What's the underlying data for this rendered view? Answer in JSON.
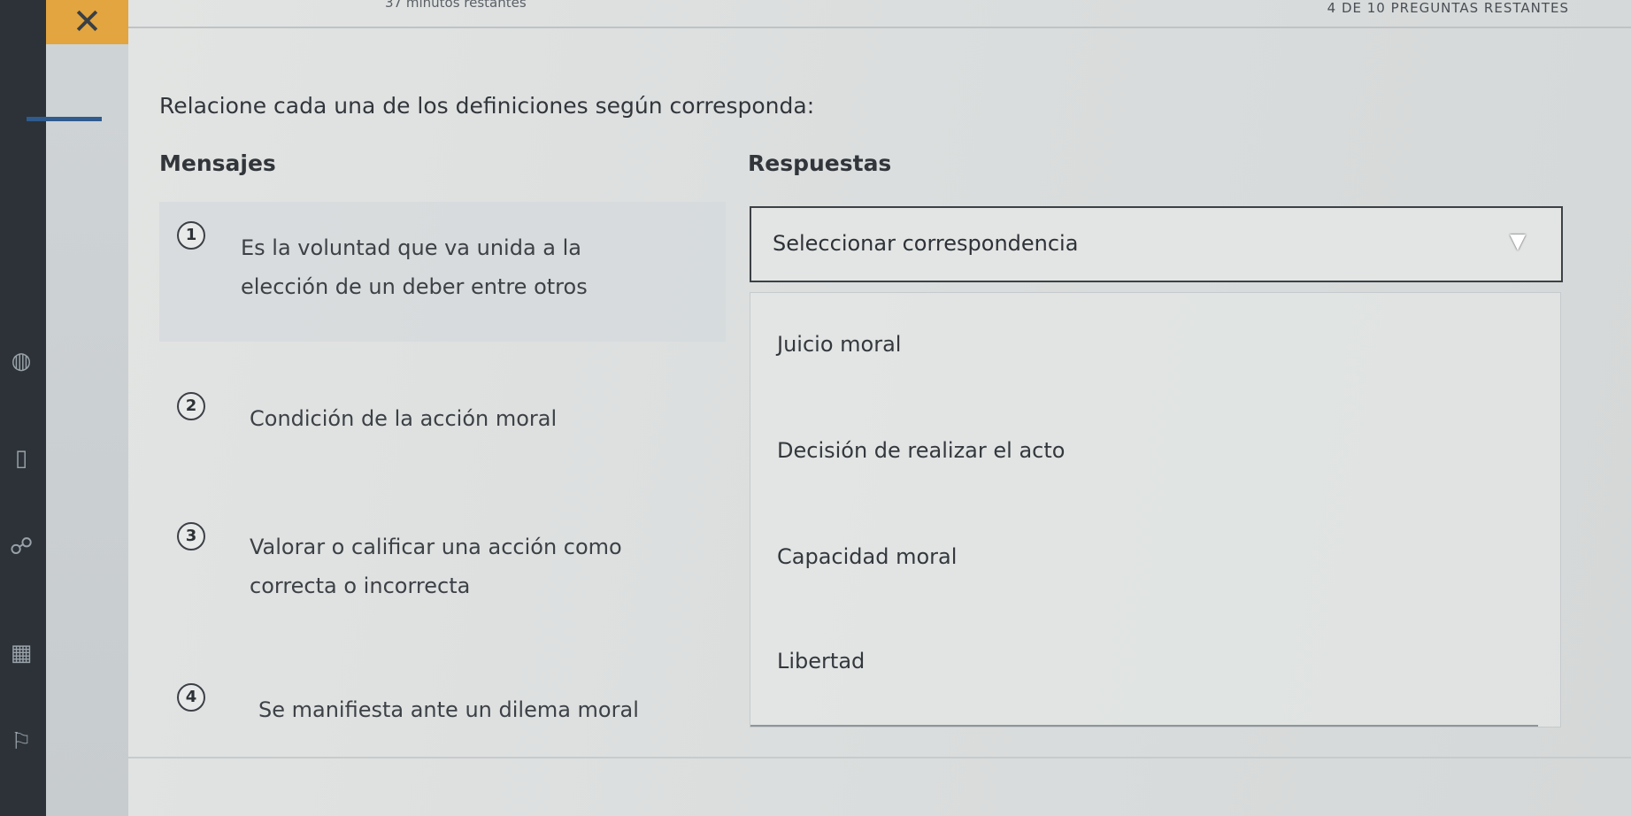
{
  "header": {
    "timer_text": "37 minutos restantes",
    "remaining_text": "4 DE 10 PREGUNTAS RESTANTES"
  },
  "close_button": {
    "symbol": "✕"
  },
  "instruction": "Relacione cada una de los definiciones según corresponda:",
  "columns": {
    "left_title": "Mensajes",
    "right_title": "Respuestas"
  },
  "questions": [
    {
      "num": "1",
      "text": "Es la voluntad que va unida a la elección de un deber entre otros"
    },
    {
      "num": "2",
      "text": "Condición de la acción moral"
    },
    {
      "num": "3",
      "text": "Valorar o calificar una acción como correcta o incorrecta"
    },
    {
      "num": "4",
      "text": "Se manifiesta ante un dilema moral"
    }
  ],
  "select": {
    "placeholder": "Seleccionar correspondencia",
    "options": [
      "Juicio moral",
      "Decisión de realizar el acto",
      "Capacidad moral",
      "Libertad"
    ]
  },
  "icons": {
    "close": "close-icon",
    "dropdown": "cursor-arrow-icon"
  },
  "colors": {
    "accent_orange": "#e2a53f",
    "rail_blue": "#2f5b8e"
  }
}
